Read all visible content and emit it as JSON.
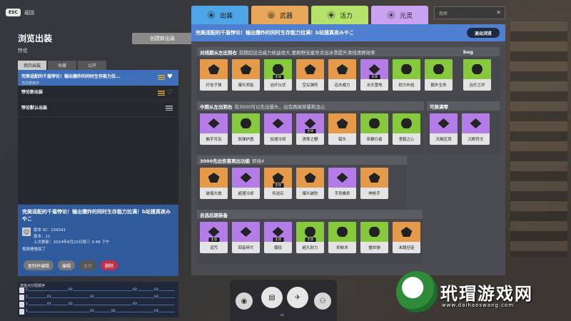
{
  "esc": {
    "key": "ESC",
    "label": "返回"
  },
  "left": {
    "title": "浏览出装",
    "hero": "怜伦",
    "create_button": "创建新出装",
    "tabs": [
      "我的出装",
      "收藏",
      "公开"
    ],
    "builds": [
      {
        "name": "完美适配的千盾悖论！输出爆炸的同时生存能力拉...",
        "sub": "当前使用中",
        "selected": true
      },
      {
        "name": "悖论新出装",
        "sub": "",
        "selected": false
      },
      {
        "name": "悖论默认出装",
        "sub": "",
        "selected": false
      }
    ]
  },
  "detail": {
    "title": "完美适配的千盾悖论！输出爆炸的同时生存能力拉满！b站搜真夜みやこ",
    "version_id": "版本 ID：159341",
    "version": "版本：11",
    "updated": "上次更新：2024年8月20日周三 3:48 下午",
    "desc": "视频慢慢搞了",
    "buttons": {
      "copy_edit": "复制并编辑",
      "edit": "编辑",
      "publish": "发布",
      "delete": "删除"
    }
  },
  "timeline": {
    "title": "技能点分配顺序",
    "rows": [
      [
        "1",
        "",
        "01",
        "",
        "",
        "02",
        "03"
      ],
      [
        "1",
        "01",
        "",
        "02",
        "",
        "",
        "03"
      ],
      [
        "1",
        "01",
        "02",
        "",
        "",
        "03",
        ""
      ],
      [
        "1",
        "",
        "",
        "01",
        "02",
        "",
        "03"
      ]
    ]
  },
  "tabs": [
    {
      "label": "出装",
      "icon": "star-icon"
    },
    {
      "label": "武器",
      "icon": "target-icon"
    },
    {
      "label": "活力",
      "icon": "vitality-icon"
    },
    {
      "label": "元灵",
      "icon": "spirit-icon"
    }
  ],
  "search": {
    "placeholder": "搜索"
  },
  "main": {
    "title": "完美适配的千盾悖论！输出爆炸的同时生存能力拉满！b站搜真夜みやこ",
    "exit_button": "退出浏览",
    "core_label": "主动",
    "sections": [
      {
        "title": "对线期从左出到右",
        "note": "前期怼远击威力收益很大,要刷野支援早点出冰雪提升清线清野效率",
        "items": [
          {
            "label": "疗愈子弹",
            "color": "orange",
            "core": false
          },
          {
            "label": "爆头奖励",
            "color": "orange",
            "core": false
          },
          {
            "label": "治疗仪式",
            "color": "green",
            "core": true
          },
          {
            "label": "空尖弹药",
            "color": "orange",
            "core": false
          },
          {
            "label": "远击威力",
            "color": "orange",
            "core": false
          },
          {
            "label": "冰天雪地",
            "color": "purple",
            "core": true
          },
          {
            "label": "耐力补给",
            "color": "green",
            "core": false
          },
          {
            "label": "额外生命",
            "color": "green",
            "core": false
          }
        ]
      },
      {
        "title": "bug",
        "note": "",
        "items": [
          {
            "label": "治疗之环",
            "color": "green",
            "core": false
          }
        ]
      },
      {
        "title": "中期从左出到右",
        "note": "有3000可以先出猎头，出完再搞穿暴和龙心",
        "items": [
          {
            "label": "触手可及",
            "color": "purple",
            "core": false
          },
          {
            "label": "防弹护盾",
            "color": "green",
            "core": false
          },
          {
            "label": "加速冷却",
            "color": "purple",
            "core": false
          },
          {
            "label": "清零之鞭",
            "color": "purple",
            "core": true
          },
          {
            "label": "猎头",
            "color": "orange",
            "core": false
          },
          {
            "label": "穿暴行者",
            "color": "green",
            "core": false
          },
          {
            "label": "坚毅之心",
            "color": "green",
            "core": false
          }
        ]
      },
      {
        "title": "可换满零",
        "note": "",
        "items": [
          {
            "label": "天赐压顶",
            "color": "purple",
            "core": false
          },
          {
            "label": "沉默符文",
            "color": "purple",
            "core": false
          }
        ]
      },
      {
        "title": "3000先出伤害再出功能",
        "note": "即插4",
        "items": [
          {
            "label": "玻璃大炮",
            "color": "orange",
            "core": false
          },
          {
            "label": "超速冷却",
            "color": "purple",
            "core": false
          },
          {
            "label": "传送石",
            "color": "orange",
            "core": true
          },
          {
            "label": "爆头破防",
            "color": "orange",
            "core": false
          },
          {
            "label": "手到擒来",
            "color": "purple",
            "core": false
          },
          {
            "label": "神枪手",
            "color": "orange",
            "core": false
          }
        ]
      },
      {
        "title": "自选后期装备",
        "note": "",
        "items": [
          {
            "label": "诅咒",
            "color": "purple",
            "core": true
          },
          {
            "label": "回音碎片",
            "color": "purple",
            "core": false
          },
          {
            "label": "魔毯",
            "color": "purple",
            "core": true
          },
          {
            "label": "超凡耐力",
            "color": "green",
            "core": true
          },
          {
            "label": "抑制术",
            "color": "green",
            "core": false
          },
          {
            "label": "撞命弹",
            "color": "green",
            "core": false
          },
          {
            "label": "末路狂徒",
            "color": "orange",
            "core": false
          }
        ]
      }
    ]
  },
  "watermark": {
    "brand": "玳瑁游戏网",
    "url": "www.daihaoswang.com"
  }
}
